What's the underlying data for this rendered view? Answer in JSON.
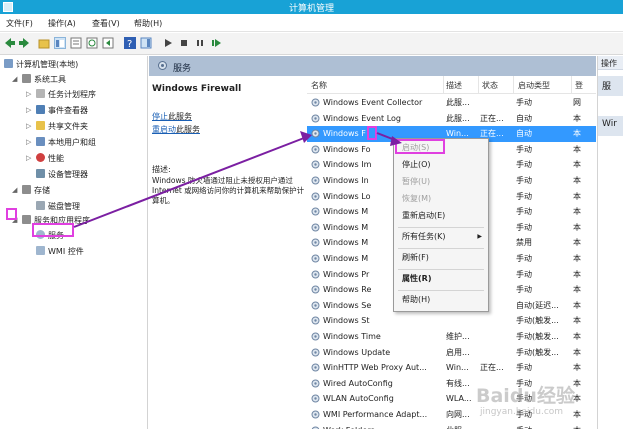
{
  "window": {
    "title": "计算机管理"
  },
  "menu": [
    "文件(F)",
    "操作(A)",
    "查看(V)",
    "帮助(H)"
  ],
  "tree": {
    "root": "计算机管理(本地)",
    "system_tools": "系统工具",
    "task_scheduler": "任务计划程序",
    "event_viewer": "事件查看器",
    "shared_folders": "共享文件夹",
    "local_users": "本地用户和组",
    "performance": "性能",
    "device_manager": "设备管理器",
    "storage": "存储",
    "disk_management": "磁盘管理",
    "services_apps": "服务和应用程序",
    "services": "服务",
    "wmi": "WMI 控件"
  },
  "panel": {
    "title": "服务"
  },
  "details": {
    "service_name": "Windows Firewall",
    "stop_link": "停止",
    "stop_rest": "此服务",
    "restart_link": "重启动",
    "restart_rest": "此服务",
    "desc_label": "描述:",
    "desc_text": "Windows 防火墙通过阻止未授权用户通过 Internet 或网络访问你的计算机来帮助保护计算机。"
  },
  "list_headers": {
    "name": "名称",
    "desc": "描述",
    "status": "状态",
    "startup": "启动类型",
    "extra": "登"
  },
  "services": [
    {
      "name": "Windows Event Collector",
      "desc": "此服...",
      "status": "",
      "startup": "手动",
      "extra": "网"
    },
    {
      "name": "Windows Event Log",
      "desc": "此服...",
      "status": "正在...",
      "startup": "自动",
      "extra": "本"
    },
    {
      "name": "Windows F",
      "desc": "Win...",
      "status": "正在...",
      "startup": "自动",
      "extra": "本"
    },
    {
      "name": "Windows Fo",
      "desc": "",
      "status": "",
      "startup": "手动",
      "extra": "本"
    },
    {
      "name": "Windows Im",
      "desc": "",
      "status": "",
      "startup": "手动",
      "extra": "本"
    },
    {
      "name": "Windows In",
      "desc": "",
      "status": "",
      "startup": "手动",
      "extra": "本"
    },
    {
      "name": "Windows Lo",
      "desc": "",
      "status": "",
      "startup": "手动",
      "extra": "本"
    },
    {
      "name": "Windows M",
      "desc": "",
      "status": "",
      "startup": "手动",
      "extra": "本"
    },
    {
      "name": "Windows M",
      "desc": "",
      "status": "",
      "startup": "手动",
      "extra": "本"
    },
    {
      "name": "Windows M",
      "desc": "",
      "status": "",
      "startup": "禁用",
      "extra": "本"
    },
    {
      "name": "Windows M",
      "desc": "",
      "status": "",
      "startup": "手动",
      "extra": "本"
    },
    {
      "name": "Windows Pr",
      "desc": "",
      "status": "",
      "startup": "手动",
      "extra": "本"
    },
    {
      "name": "Windows Re",
      "desc": "",
      "status": "",
      "startup": "手动",
      "extra": "本"
    },
    {
      "name": "Windows Se",
      "desc": "",
      "status": "",
      "startup": "自动(延迟...",
      "extra": "本"
    },
    {
      "name": "Windows St",
      "desc": "",
      "status": "",
      "startup": "手动(触发...",
      "extra": "本"
    },
    {
      "name": "Windows Time",
      "desc": "维护...",
      "status": "",
      "startup": "手动(触发...",
      "extra": "本"
    },
    {
      "name": "Windows Update",
      "desc": "启用...",
      "status": "",
      "startup": "手动(触发...",
      "extra": "本"
    },
    {
      "name": "WinHTTP Web Proxy Aut...",
      "desc": "Win...",
      "status": "正在...",
      "startup": "手动",
      "extra": "本"
    },
    {
      "name": "Wired AutoConfig",
      "desc": "有线...",
      "status": "",
      "startup": "手动",
      "extra": "本"
    },
    {
      "name": "WLAN AutoConfig",
      "desc": "WLA...",
      "status": "",
      "startup": "手动",
      "extra": "本"
    },
    {
      "name": "WMI Performance Adapt...",
      "desc": "向网...",
      "status": "",
      "startup": "手动",
      "extra": "本"
    },
    {
      "name": "Work Folders",
      "desc": "此服...",
      "status": "",
      "startup": "手动",
      "extra": "本"
    }
  ],
  "context_menu": {
    "start": "启动(S)",
    "stop": "停止(O)",
    "pause": "暂停(U)",
    "resume": "恢复(M)",
    "restart": "重新启动(E)",
    "all_tasks": "所有任务(K)",
    "refresh": "刷新(F)",
    "properties": "属性(R)",
    "help": "帮助(H)"
  },
  "actions": {
    "header": "操作",
    "section1": "服",
    "section2": "Wir"
  },
  "watermark": {
    "text": "Baidu经验",
    "sub": "jingyan.baidu.com"
  },
  "colors": {
    "titlebar": "#18a2d6",
    "selection": "#3399ff",
    "highlight": "#e040e0",
    "arrow": "#7b1fa2"
  }
}
